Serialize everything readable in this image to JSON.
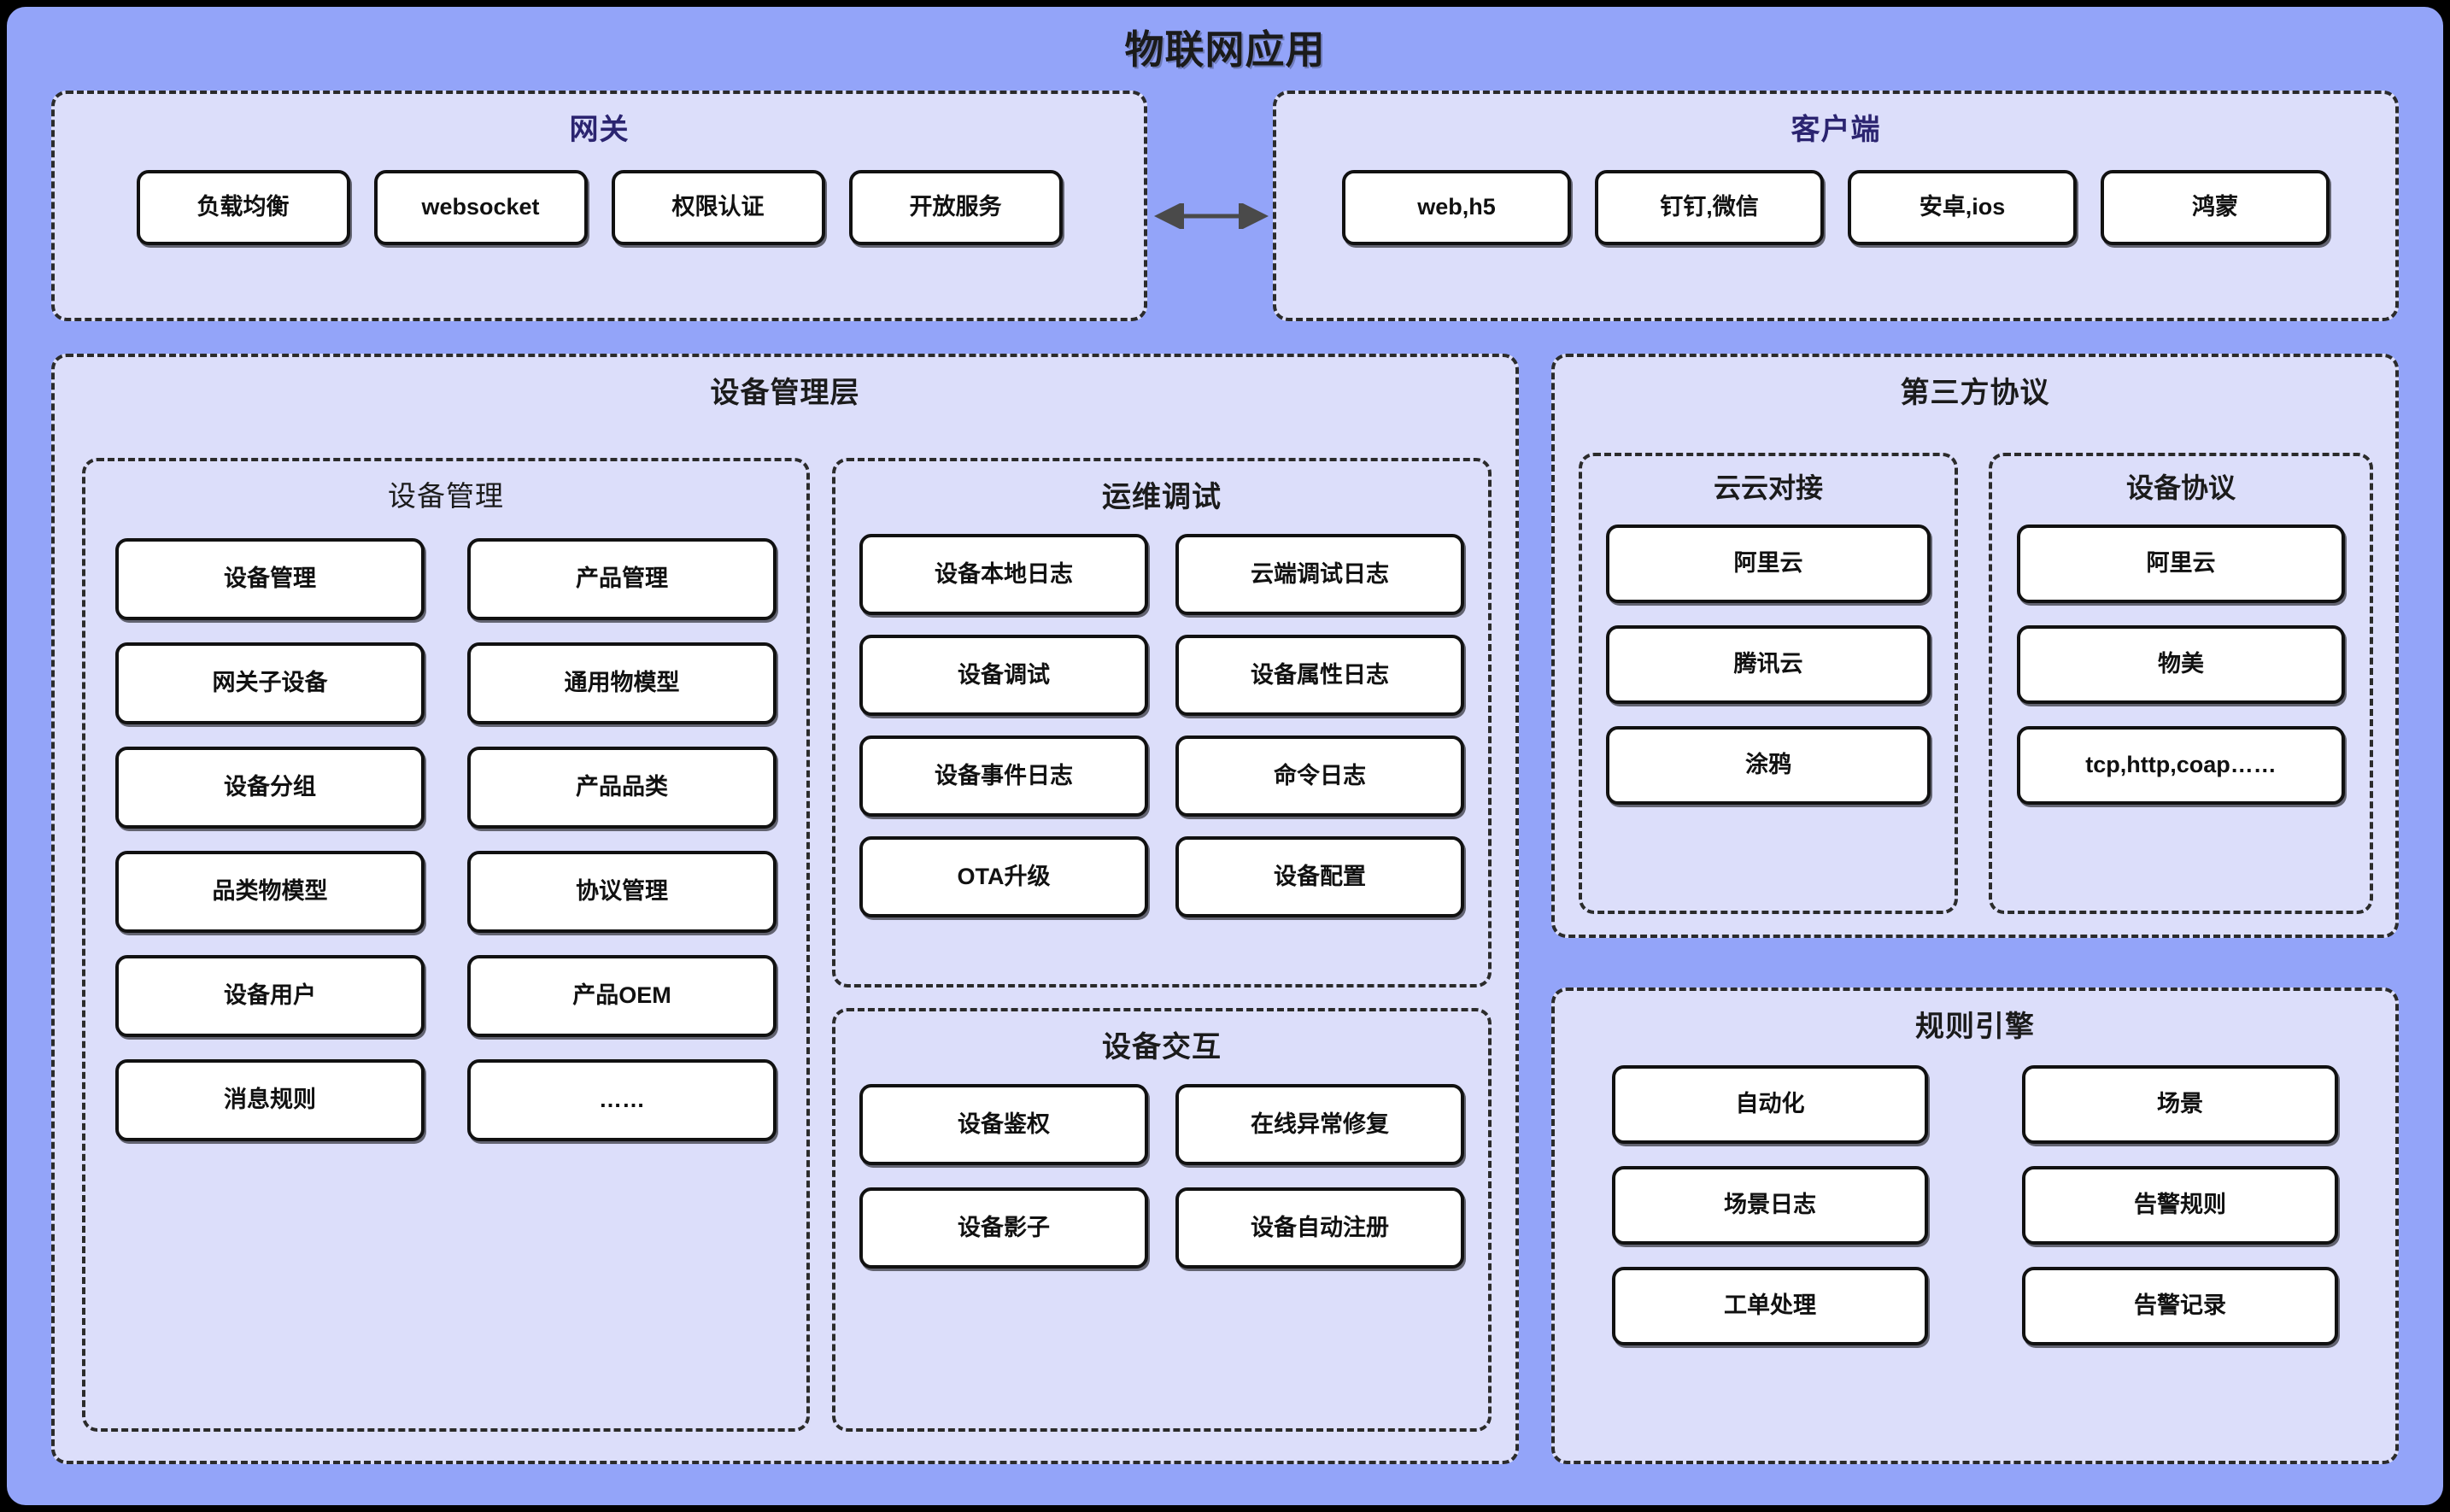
{
  "app": {
    "title": "物联网应用",
    "colors": {
      "frame_bg": "#93a4f9",
      "panel_bg": "#dcdefa",
      "chip_bg": "#ffffff",
      "chip_border": "#111111",
      "accent_title": "#2b2470",
      "arrow": "#4a4a4a"
    }
  },
  "gateway": {
    "title": "网关",
    "items": [
      {
        "label": "负载均衡"
      },
      {
        "label": "websocket"
      },
      {
        "label": "权限认证"
      },
      {
        "label": "开放服务"
      }
    ]
  },
  "client": {
    "title": "客户端",
    "items": [
      {
        "label": "web,h5"
      },
      {
        "label": "钉钉,微信"
      },
      {
        "label": "安卓,ios"
      },
      {
        "label": "鸿蒙"
      }
    ]
  },
  "connector": {
    "icon": "double-arrow-icon"
  },
  "device_layer": {
    "title": "设备管理层",
    "device_management": {
      "title": "设备管理",
      "items": [
        {
          "label": "设备管理"
        },
        {
          "label": "产品管理"
        },
        {
          "label": "网关子设备"
        },
        {
          "label": "通用物模型"
        },
        {
          "label": "设备分组"
        },
        {
          "label": "产品品类"
        },
        {
          "label": "品类物模型"
        },
        {
          "label": "协议管理"
        },
        {
          "label": "设备用户"
        },
        {
          "label": "产品OEM"
        },
        {
          "label": "消息规则"
        },
        {
          "label": "……"
        }
      ]
    },
    "ops_debug": {
      "title": "运维调试",
      "items": [
        {
          "label": "设备本地日志"
        },
        {
          "label": "云端调试日志"
        },
        {
          "label": "设备调试"
        },
        {
          "label": "设备属性日志"
        },
        {
          "label": "设备事件日志"
        },
        {
          "label": "命令日志"
        },
        {
          "label": "OTA升级"
        },
        {
          "label": "设备配置"
        }
      ]
    },
    "device_interaction": {
      "title": "设备交互",
      "items": [
        {
          "label": "设备鉴权"
        },
        {
          "label": "在线异常修复"
        },
        {
          "label": "设备影子"
        },
        {
          "label": "设备自动注册"
        }
      ]
    }
  },
  "third_party": {
    "title": "第三方协议",
    "cloud_docking": {
      "title": "云云对接",
      "items": [
        {
          "label": "阿里云"
        },
        {
          "label": "腾讯云"
        },
        {
          "label": "涂鸦"
        }
      ]
    },
    "device_protocol": {
      "title": "设备协议",
      "items": [
        {
          "label": "阿里云"
        },
        {
          "label": "物美"
        },
        {
          "label": "tcp,http,coap……"
        }
      ]
    }
  },
  "rule_engine": {
    "title": "规则引擎",
    "items": [
      {
        "label": "自动化"
      },
      {
        "label": "场景"
      },
      {
        "label": "场景日志"
      },
      {
        "label": "告警规则"
      },
      {
        "label": "工单处理"
      },
      {
        "label": "告警记录"
      }
    ]
  }
}
